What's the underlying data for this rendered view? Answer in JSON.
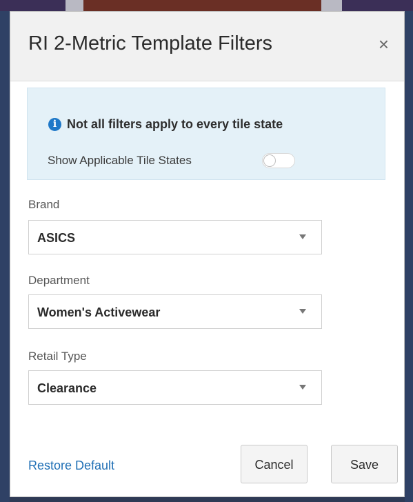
{
  "dialog": {
    "title": "RI 2-Metric Template Filters",
    "close_symbol": "×"
  },
  "info": {
    "icon": "info-icon",
    "icon_glyph": "i",
    "message": "Not all filters apply to every tile state",
    "toggle_label": "Show Applicable Tile States",
    "toggle_on": false
  },
  "filters": [
    {
      "label": "Brand",
      "value": "ASICS"
    },
    {
      "label": "Department",
      "value": "Women's Activewear"
    },
    {
      "label": "Retail Type",
      "value": "Clearance"
    }
  ],
  "footer": {
    "restore_label": "Restore Default",
    "cancel_label": "Cancel",
    "save_label": "Save"
  },
  "colors": {
    "accent": "#1e78c8",
    "link": "#1f6fb5",
    "info_bg": "#e4f1f8"
  }
}
